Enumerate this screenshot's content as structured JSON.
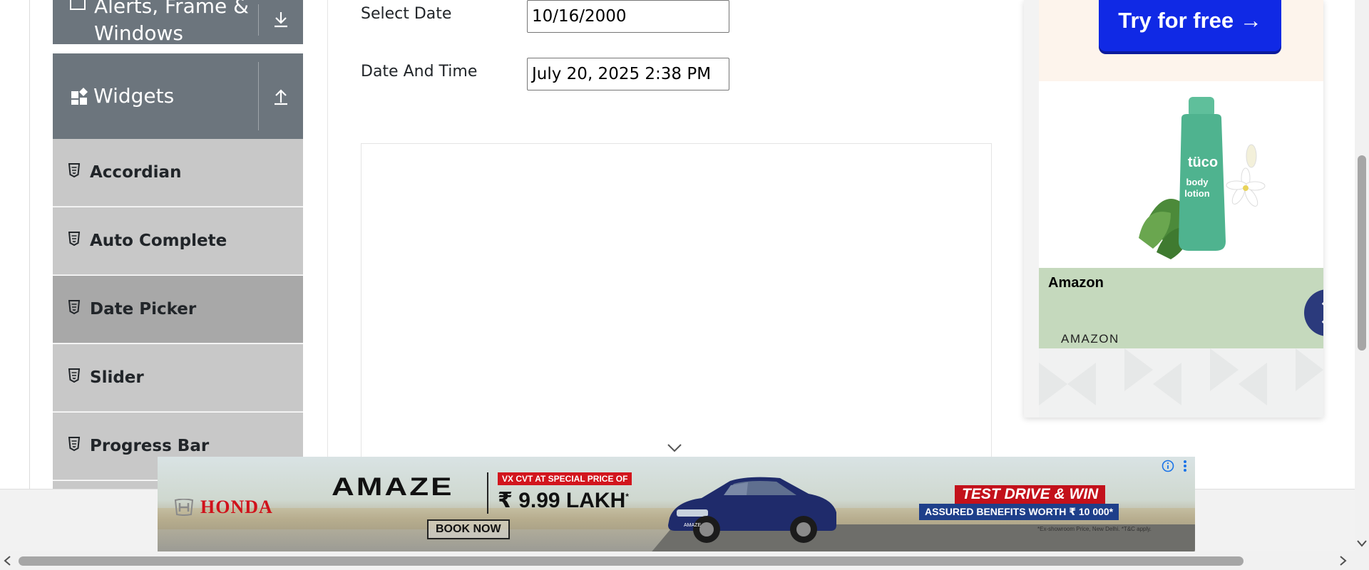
{
  "sidebar": {
    "alerts_group": {
      "label_line1": "Alerts, Frame &",
      "label_line2": "Windows"
    },
    "widgets_group": {
      "label": "Widgets"
    },
    "items": [
      {
        "label": "Accordian",
        "active": false
      },
      {
        "label": "Auto Complete",
        "active": false
      },
      {
        "label": "Date Picker",
        "active": true
      },
      {
        "label": "Slider",
        "active": false
      },
      {
        "label": "Progress Bar",
        "active": false
      }
    ]
  },
  "form": {
    "select_date": {
      "label": "Select Date",
      "value": "10/16/2000"
    },
    "date_time": {
      "label": "Date And Time",
      "value": "July 20, 2025 2:38 PM"
    }
  },
  "right_ad": {
    "cta": "Try for free →",
    "brand_title": "Amazon",
    "brand_sub": "AMAZON",
    "product_label": [
      "tüco",
      "body",
      "lotion"
    ],
    "arrow_icon": "chevron-right-icon"
  },
  "banner": {
    "brand": "HONDA",
    "model": "AMAZE",
    "offer_tag": "VX CVT AT SPECIAL PRICE OF",
    "price": "₹ 9.99 LAKH",
    "price_mark": "*",
    "book_now": "BOOK NOW",
    "test_drive": "TEST DRIVE & WIN",
    "benefits": "ASSURED BENEFITS WORTH ₹ 10 000*",
    "fine_print": "*Ex-showroom Price, New Delhi. *T&C apply.",
    "car_badge": "AMAZE"
  },
  "colors": {
    "sidebar_header": "#6c757d",
    "menu_item": "#c8c8c8",
    "menu_item_active": "#a8a8a8",
    "cta_blue": "#1029e5",
    "amazon_band": "#c5d9bd",
    "honda_red": "#d0121b"
  }
}
